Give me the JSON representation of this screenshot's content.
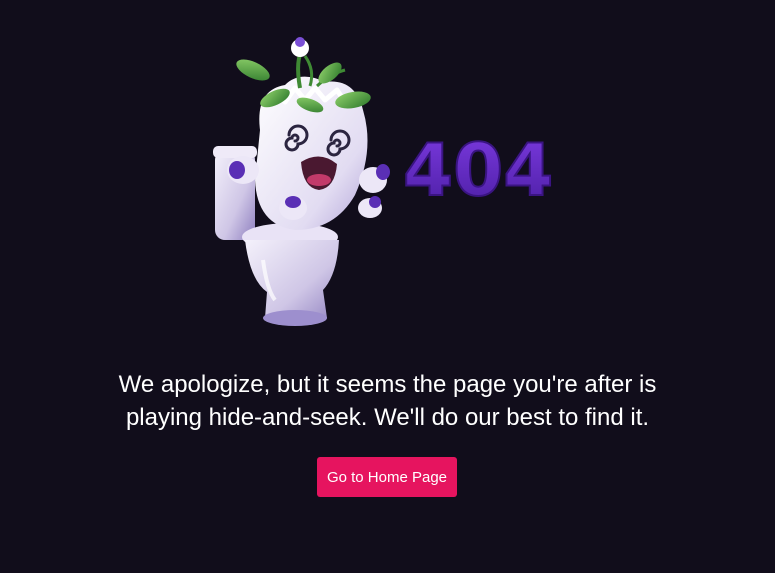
{
  "illustration": {
    "code_text": "404",
    "code_color": "#6a2bc9",
    "character": "turnip-in-toilet-character"
  },
  "message": {
    "line1": "We apologize, but it seems the page you're after is",
    "line2": "playing hide-and-seek. We'll do our best to find it."
  },
  "home_button": {
    "label": "Go to Home Page",
    "color": "#e6145f"
  },
  "colors": {
    "background": "#110d1b",
    "text": "#ffffff"
  }
}
